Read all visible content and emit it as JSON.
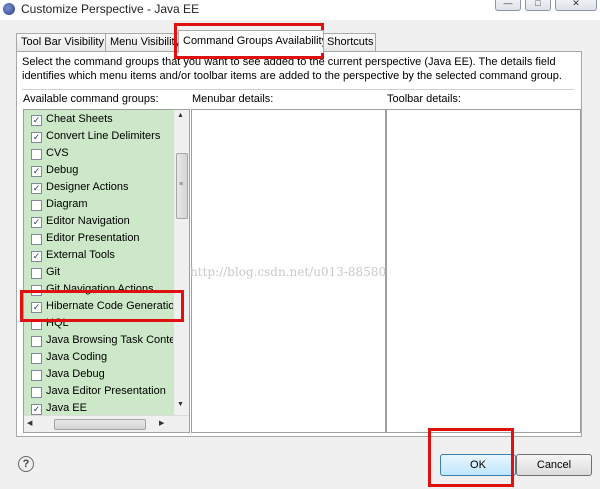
{
  "window": {
    "title": "Customize Perspective - Java EE",
    "controls": [
      "—",
      "□",
      "✕"
    ]
  },
  "tabs": [
    {
      "label": "Tool Bar Visibility",
      "active": false
    },
    {
      "label": "Menu Visibility",
      "active": false
    },
    {
      "label": "Command Groups Availability",
      "active": true
    },
    {
      "label": "Shortcuts",
      "active": false
    }
  ],
  "panel": {
    "description": "Select the command groups that you want to see added to the current perspective (Java EE).  The details field identifies which menu items and/or toolbar items are added to the perspective by the selected command group.",
    "available_header": "Available command groups:",
    "menubar_header": "Menubar details:",
    "toolbar_header": "Toolbar details:",
    "command_groups": [
      {
        "label": "Cheat Sheets",
        "checked": true
      },
      {
        "label": "Convert Line Delimiters",
        "checked": true
      },
      {
        "label": "CVS",
        "checked": false
      },
      {
        "label": "Debug",
        "checked": true
      },
      {
        "label": "Designer Actions",
        "checked": true
      },
      {
        "label": "Diagram",
        "checked": false
      },
      {
        "label": "Editor Navigation",
        "checked": true
      },
      {
        "label": "Editor Presentation",
        "checked": false
      },
      {
        "label": "External Tools",
        "checked": true
      },
      {
        "label": "Git",
        "checked": false
      },
      {
        "label": "Git Navigation Actions",
        "checked": false
      },
      {
        "label": "Hibernate Code Generation",
        "checked": true
      },
      {
        "label": "HQL",
        "checked": false
      },
      {
        "label": "Java Browsing Task Context",
        "checked": false
      },
      {
        "label": "Java Coding",
        "checked": false
      },
      {
        "label": "Java Debug",
        "checked": false
      },
      {
        "label": "Java Editor Presentation",
        "checked": false
      },
      {
        "label": "Java EE",
        "checked": true
      }
    ],
    "watermark": "http://blog.csdn.net/u013-88580"
  },
  "buttons": {
    "help": "?",
    "ok": "OK",
    "cancel": "Cancel"
  },
  "colors": {
    "list_background": "#cde8c8",
    "annotation_red": "#e01010",
    "dialog_background": "#f0f0f0"
  }
}
